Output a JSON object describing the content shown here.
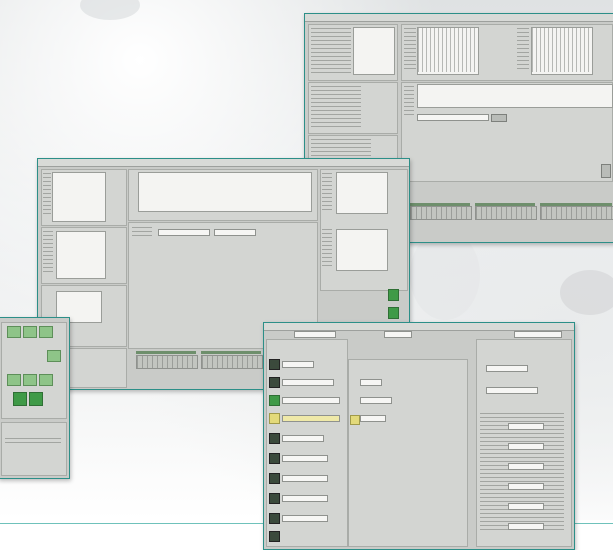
{
  "scene": {
    "description_free": true,
    "accent_color": "#2c8f88",
    "rule_color": "#6fc2bb",
    "window_color": "#c9cbc8"
  },
  "windows": [
    {
      "id": "top-right-window"
    },
    {
      "id": "middle-window"
    },
    {
      "id": "left-partial-window"
    },
    {
      "id": "bottom-window"
    }
  ]
}
